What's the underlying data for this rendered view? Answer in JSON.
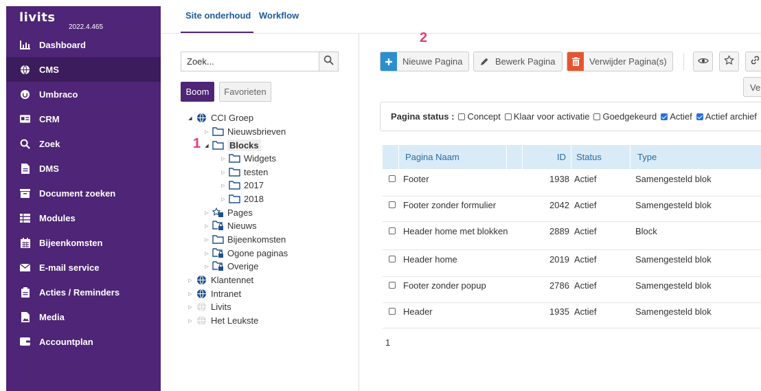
{
  "app": {
    "logo": "livits",
    "version": "2022.4.465"
  },
  "sidebar": {
    "items": [
      {
        "label": "Dashboard",
        "icon": "chart-icon"
      },
      {
        "label": "CMS",
        "icon": "globe-icon"
      },
      {
        "label": "Umbraco",
        "icon": "umbraco-icon"
      },
      {
        "label": "CRM",
        "icon": "id-card-icon"
      },
      {
        "label": "Zoek",
        "icon": "search-icon"
      },
      {
        "label": "DMS",
        "icon": "file-icon"
      },
      {
        "label": "Document zoeken",
        "icon": "archive-icon"
      },
      {
        "label": "Modules",
        "icon": "list-icon"
      },
      {
        "label": "Bijeenkomsten",
        "icon": "calendar-icon"
      },
      {
        "label": "E-mail service",
        "icon": "envelope-icon"
      },
      {
        "label": "Acties / Reminders",
        "icon": "clipboard-icon"
      },
      {
        "label": "Media",
        "icon": "image-file-icon"
      },
      {
        "label": "Accountplan",
        "icon": "wallet-icon"
      }
    ]
  },
  "tabs": [
    {
      "label": "Site onderhoud"
    },
    {
      "label": "Workflow"
    }
  ],
  "search": {
    "placeholder": "Zoek..."
  },
  "view_toggle": {
    "boom": "Boom",
    "favorieten": "Favorieten"
  },
  "annotations": {
    "one": "1",
    "two": "2"
  },
  "tree": [
    {
      "label": "CCI Groep",
      "icon": "globe-icon",
      "expanded": true
    },
    {
      "label": "Nieuwsbrieven",
      "icon": "folder-icon"
    },
    {
      "label": "Blocks",
      "icon": "folder-icon",
      "expanded": true,
      "selected": true
    },
    {
      "label": "Widgets",
      "icon": "folder-icon"
    },
    {
      "label": "testen",
      "icon": "folder-icon"
    },
    {
      "label": "2017",
      "icon": "folder-icon"
    },
    {
      "label": "2018",
      "icon": "folder-icon"
    },
    {
      "label": "Pages",
      "icon": "star-folder-icon"
    },
    {
      "label": "Nieuws",
      "icon": "locked-folder-icon"
    },
    {
      "label": "Bijeenkomsten",
      "icon": "folder-icon"
    },
    {
      "label": "Ogone paginas",
      "icon": "locked-folder-icon"
    },
    {
      "label": "Overige",
      "icon": "locked-folder-icon"
    },
    {
      "label": "Klantennet",
      "icon": "globe-icon"
    },
    {
      "label": "Intranet",
      "icon": "globe-icon"
    },
    {
      "label": "Livits",
      "icon": "globe-faded-icon"
    },
    {
      "label": "Het Leukste",
      "icon": "globe-faded-icon"
    }
  ],
  "toolbar": {
    "new_page": "Nieuwe Pagina",
    "edit_page": "Bewerk Pagina",
    "delete_pages": "Verwijder Pagina(s)",
    "ver_partial": "Ver"
  },
  "status_filter": {
    "label": "Pagina status :",
    "options": [
      {
        "label": "Concept",
        "checked": false
      },
      {
        "label": "Klaar voor activatie",
        "checked": false
      },
      {
        "label": "Goedgekeurd",
        "checked": false
      },
      {
        "label": "Actief",
        "checked": true
      },
      {
        "label": "Actief archief",
        "checked": true
      }
    ]
  },
  "table": {
    "headers": {
      "name": "Pagina Naam",
      "id": "ID",
      "status": "Status",
      "type": "Type"
    },
    "rows": [
      {
        "name": "Footer",
        "id": "1938",
        "status": "Actief",
        "type": "Samengesteld blok"
      },
      {
        "name": "Footer zonder formulier",
        "id": "2042",
        "status": "Actief",
        "type": "Samengesteld blok"
      },
      {
        "name": "Header home met blokken",
        "id": "2889",
        "status": "Actief",
        "type": "Block"
      },
      {
        "name": "Header home",
        "id": "2019",
        "status": "Actief",
        "type": "Samengesteld blok"
      },
      {
        "name": "Footer zonder popup",
        "id": "2786",
        "status": "Actief",
        "type": "Samengesteld blok"
      },
      {
        "name": "Header",
        "id": "1935",
        "status": "Actief",
        "type": "Samengesteld blok"
      }
    ]
  },
  "pagination": {
    "current": "1"
  },
  "colors": {
    "sidebar": "#4e2577",
    "sidebar_active": "#3c1c5c",
    "primary": "#2a8fcf",
    "danger": "#e8542f",
    "annotation": "#e63977",
    "table_header": "#d9ebf7",
    "link": "#1d5a99"
  }
}
